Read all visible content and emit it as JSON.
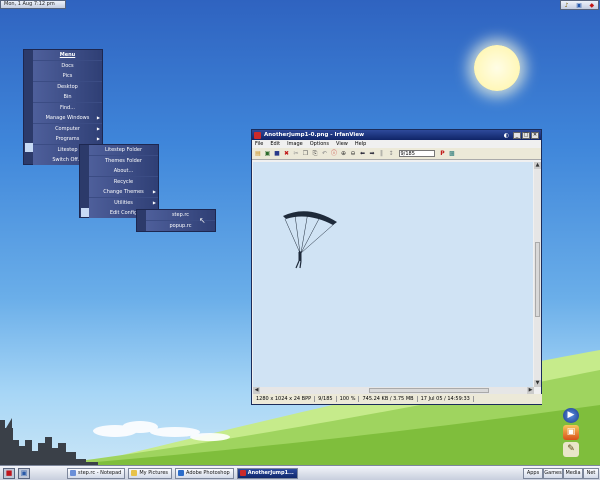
{
  "topbar": {
    "clock": "Mon, 1 Aug   7:12 pm",
    "tray_icons": [
      "bell-icon",
      "network-icon",
      "shield-icon"
    ]
  },
  "main_menu": {
    "items": [
      {
        "label": "Menu",
        "bold": true
      },
      {
        "label": "Docs"
      },
      {
        "label": "Pics"
      },
      {
        "label": "Desktop"
      },
      {
        "label": "Bin"
      },
      {
        "label": "Find..."
      },
      {
        "label": "Manage Windows",
        "has_submenu": true
      },
      {
        "label": "Computer",
        "has_submenu": true
      },
      {
        "label": "Programs",
        "has_submenu": true
      },
      {
        "label": "Litestep",
        "has_submenu": true,
        "highlighted": true
      },
      {
        "label": "Switch Off...",
        "has_submenu": true
      }
    ]
  },
  "litestep_menu": {
    "items": [
      {
        "label": "Litestep Folder"
      },
      {
        "label": "Themes Folder"
      },
      {
        "label": "About..."
      },
      {
        "label": "Recycle"
      },
      {
        "label": "Change Themes",
        "has_submenu": true
      },
      {
        "label": "Utilities",
        "has_submenu": true
      },
      {
        "label": "Edit Config",
        "has_submenu": true,
        "highlighted": true
      }
    ]
  },
  "config_menu": {
    "items": [
      {
        "label": "step.rc"
      },
      {
        "label": "popup.rc"
      }
    ]
  },
  "irfanview": {
    "title": "AnotherJump1-0.png - IrfanView",
    "menu": [
      "File",
      "Edit",
      "Image",
      "Options",
      "View",
      "Help"
    ],
    "page_field": "9/185",
    "status": [
      "1280 x 1024 x 24 BPP",
      "9/185",
      "100 %",
      "745.24 KB / 3.75 MB",
      "17 Jul 05 / 14:59:33"
    ],
    "toolbar_icons": [
      "open-folder-icon",
      "slideshow-icon",
      "save-icon",
      "delete-icon",
      "cut-icon",
      "copy-icon",
      "paste-icon",
      "undo-icon",
      "info-icon",
      "zoom-in-icon",
      "zoom-out-icon",
      "previous-icon",
      "next-icon",
      "pause-icon",
      "print-icon",
      "image-icon"
    ]
  },
  "dock_icons": [
    "media-player-icon",
    "photo-icon",
    "pencil-icon"
  ],
  "taskbar": {
    "tasks": [
      {
        "label": "step.rc - Notepad",
        "icon": "notepad-icon",
        "color": "#6a8fd8"
      },
      {
        "label": "My Pictures",
        "icon": "folder-icon",
        "color": "#e7c24a"
      },
      {
        "label": "Adobe Photoshop",
        "icon": "photoshop-icon",
        "color": "#2b6cc9"
      },
      {
        "label": "AnotherJump1...",
        "icon": "irfanview-icon",
        "color": "#cc2a2a",
        "active": true
      }
    ],
    "tabs": [
      "Apps",
      "Games",
      "Media",
      "Net"
    ]
  },
  "colors": {
    "menu_bg": "#3b4c84",
    "menu_highlight": "#8fb6ec",
    "title_bar": "#0f2467",
    "sky_top": "#2f63c0",
    "grass": "#9fd45f"
  }
}
